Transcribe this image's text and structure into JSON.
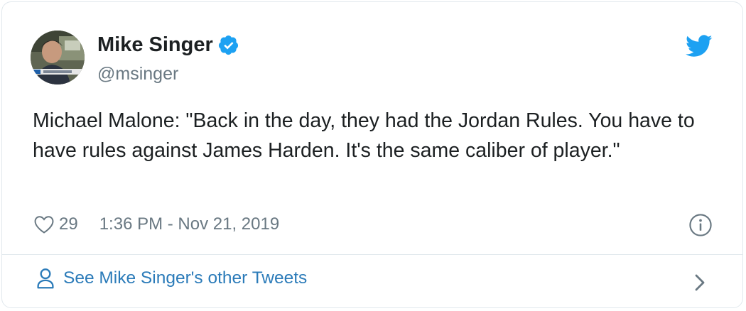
{
  "author": {
    "name": "Mike Singer",
    "handle": "@msinger",
    "verified": true
  },
  "tweet": {
    "text": "Michael Malone: \"Back in the day, they had the Jordan Rules. You have to have rules against James Harden. It's the same caliber of player.\"",
    "likes": "29",
    "timestamp": "1:36 PM - Nov 21, 2019"
  },
  "footer": {
    "label": "See Mike Singer's other Tweets"
  },
  "icons": {
    "brand": "twitter-bird-icon",
    "verified": "verified-badge-icon",
    "like": "heart-icon",
    "info": "info-icon",
    "profile": "person-icon",
    "next": "chevron-right-icon"
  },
  "colors": {
    "brand_blue": "#1da1f2",
    "link_blue": "#2b7bb9",
    "text": "#1c2022",
    "muted": "#697882",
    "border": "#e1e8ed"
  }
}
